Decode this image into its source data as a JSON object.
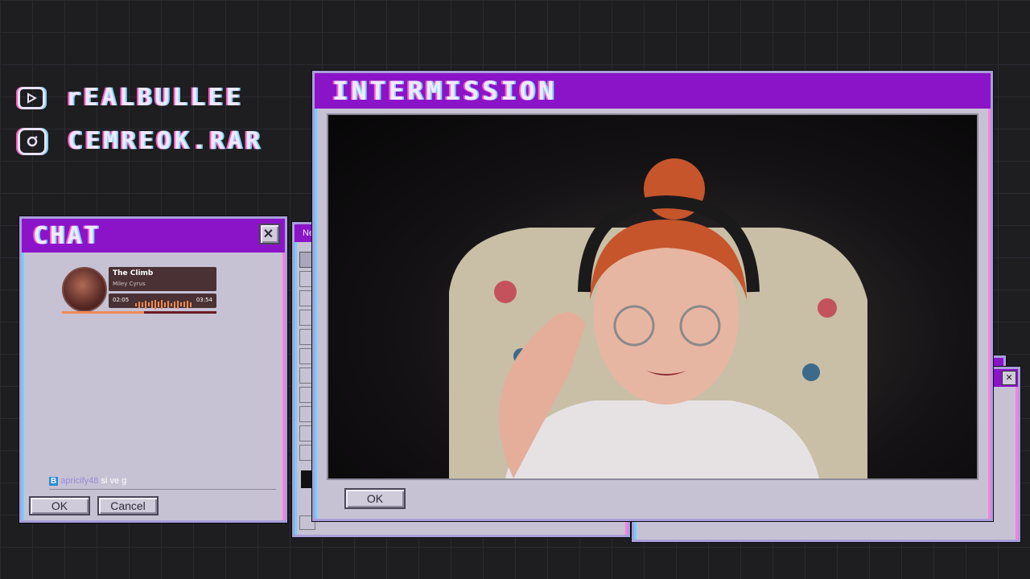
{
  "socials": [
    {
      "platform_icon": "youtube-icon",
      "handle": "rEALBULLEE"
    },
    {
      "platform_icon": "instagram-icon",
      "handle": "CEMREOK.RAR"
    }
  ],
  "chat_window": {
    "title": "CHAT",
    "close_glyph": "✕",
    "now_playing": {
      "song_title": "The Climb",
      "artist": "Miley Cyrus",
      "elapsed": "02:05",
      "duration": "03:54",
      "progress": 0.53
    },
    "message": {
      "badge": "B",
      "username": "apricify48",
      "text": "si ve g"
    },
    "ok_label": "OK",
    "cancel_label": "Cancel"
  },
  "paint_window": {
    "title_fragment": "Ne"
  },
  "main_window": {
    "title": "INTERMISSION",
    "ok_label": "OK"
  },
  "colors": {
    "titlebar": "#8b14c8",
    "window": "#c6c2d4",
    "accent_cyan": "#7ad6ff",
    "accent_pink": "#ff5cc8"
  }
}
